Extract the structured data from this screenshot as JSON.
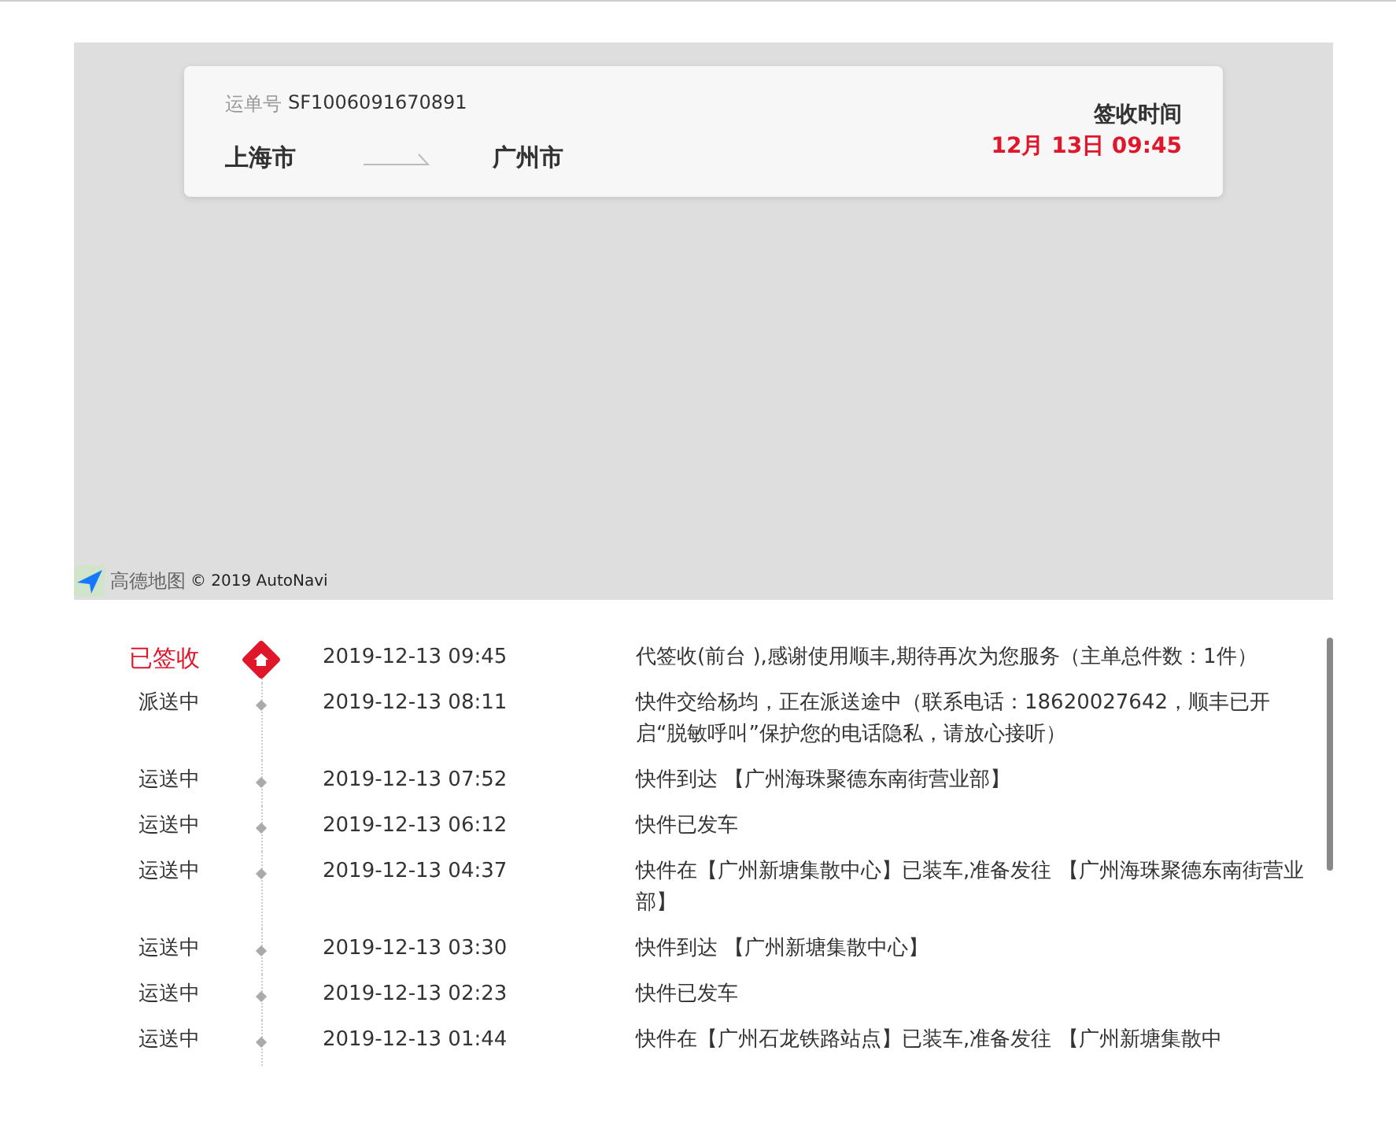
{
  "shipment": {
    "waybill_label": "运单号",
    "waybill_number": "SF1006091670891",
    "origin": "上海市",
    "destination": "广州市",
    "signed_label": "签收时间",
    "signed_time": "12月 13日 09:45"
  },
  "map": {
    "brand": "高德地图",
    "copyright": "© 2019 AutoNavi"
  },
  "events": [
    {
      "kind": "signed",
      "status": "已签收",
      "time": "2019-12-13 09:45",
      "description": "代签收(前台 ),感谢使用顺丰,期待再次为您服务（主单总件数：1件）"
    },
    {
      "kind": "transit",
      "status": "派送中",
      "time": "2019-12-13 08:11",
      "description": "快件交给杨均，正在派送途中（联系电话：18620027642，顺丰已开启“脱敏呼叫”保护您的电话隐私，请放心接听）"
    },
    {
      "kind": "transit",
      "status": "运送中",
      "time": "2019-12-13 07:52",
      "description": "快件到达 【广州海珠聚德东南街营业部】"
    },
    {
      "kind": "transit",
      "status": "运送中",
      "time": "2019-12-13 06:12",
      "description": "快件已发车"
    },
    {
      "kind": "transit",
      "status": "运送中",
      "time": "2019-12-13 04:37",
      "description": "快件在【广州新塘集散中心】已装车,准备发往 【广州海珠聚德东南街营业部】"
    },
    {
      "kind": "transit",
      "status": "运送中",
      "time": "2019-12-13 03:30",
      "description": "快件到达 【广州新塘集散中心】"
    },
    {
      "kind": "transit",
      "status": "运送中",
      "time": "2019-12-13 02:23",
      "description": "快件已发车"
    },
    {
      "kind": "transit",
      "status": "运送中",
      "time": "2019-12-13 01:44",
      "description": "快件在【广州石龙铁路站点】已装车,准备发往 【广州新塘集散中"
    }
  ]
}
